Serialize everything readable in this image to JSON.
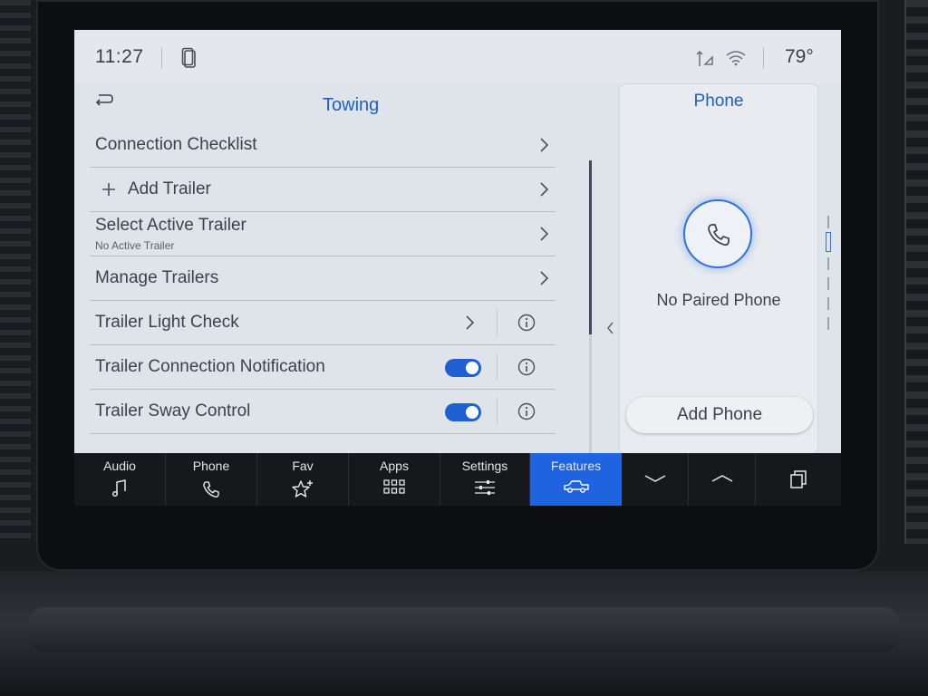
{
  "status_bar": {
    "time": "11:27",
    "temperature": "79°"
  },
  "towing": {
    "title": "Towing",
    "rows": [
      {
        "label": "Connection Checklist"
      },
      {
        "label": "Add Trailer"
      },
      {
        "label": "Select Active Trailer",
        "sub": "No Active Trailer"
      },
      {
        "label": "Manage Trailers"
      },
      {
        "label": "Trailer Light Check"
      },
      {
        "label": "Trailer Connection Notification",
        "toggle_on": true
      },
      {
        "label": "Trailer Sway Control",
        "toggle_on": true
      }
    ]
  },
  "phone_panel": {
    "title": "Phone",
    "status": "No Paired Phone",
    "add_button": "Add Phone"
  },
  "nav": {
    "items": [
      {
        "label": "Audio",
        "icon": "music-note-icon"
      },
      {
        "label": "Phone",
        "icon": "phone-icon"
      },
      {
        "label": "Fav",
        "icon": "star-plus-icon"
      },
      {
        "label": "Apps",
        "icon": "apps-grid-icon"
      },
      {
        "label": "Settings",
        "icon": "sliders-icon"
      },
      {
        "label": "Features",
        "icon": "truck-icon",
        "active": true
      }
    ]
  },
  "colors": {
    "accent": "#1f5fc2",
    "toggle_on": "#1f5fd4",
    "nav_active": "#1f63e0",
    "screen_bg": "#dfe3ea",
    "nav_bg": "#16181c"
  }
}
